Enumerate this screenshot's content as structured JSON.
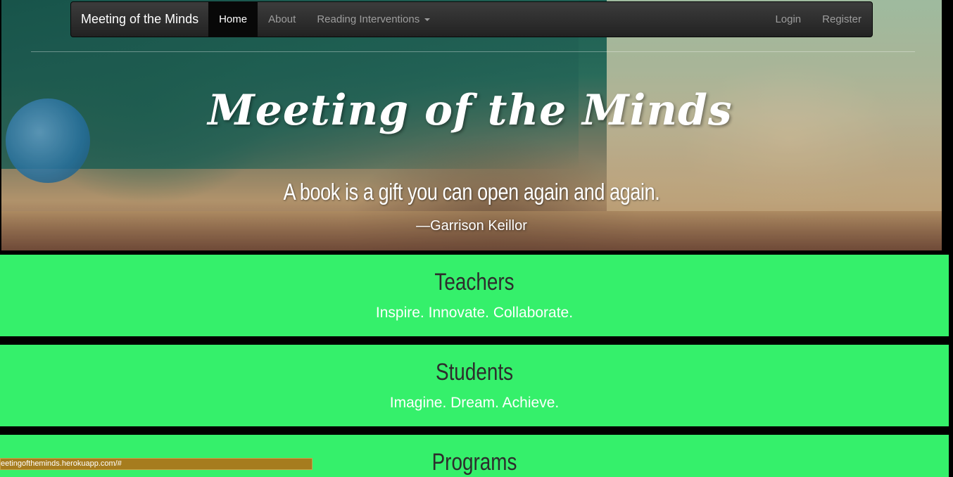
{
  "navbar": {
    "brand": "Meeting of the Minds",
    "left_items": [
      {
        "label": "Home",
        "active": true
      },
      {
        "label": "About",
        "active": false
      },
      {
        "label": "Reading Interventions",
        "active": false,
        "dropdown": true
      }
    ],
    "right_items": [
      {
        "label": "Login"
      },
      {
        "label": "Register"
      }
    ]
  },
  "hero": {
    "title": "Meeting of the Minds",
    "quote": "A book is a gift you can open again and again.",
    "author": "—Garrison Keillor"
  },
  "sections": [
    {
      "title": "Teachers",
      "subtitle": "Inspire. Innovate. Collaborate."
    },
    {
      "title": "Students",
      "subtitle": "Imagine. Dream. Achieve."
    },
    {
      "title": "Programs",
      "subtitle": ""
    }
  ],
  "status_bar": {
    "url": "eetingoftheminds.herokuapp.com/#"
  },
  "colors": {
    "section_bg": "#35f06b",
    "navbar_bg": "#222222",
    "status_bar_bg": "#a67c1e"
  }
}
